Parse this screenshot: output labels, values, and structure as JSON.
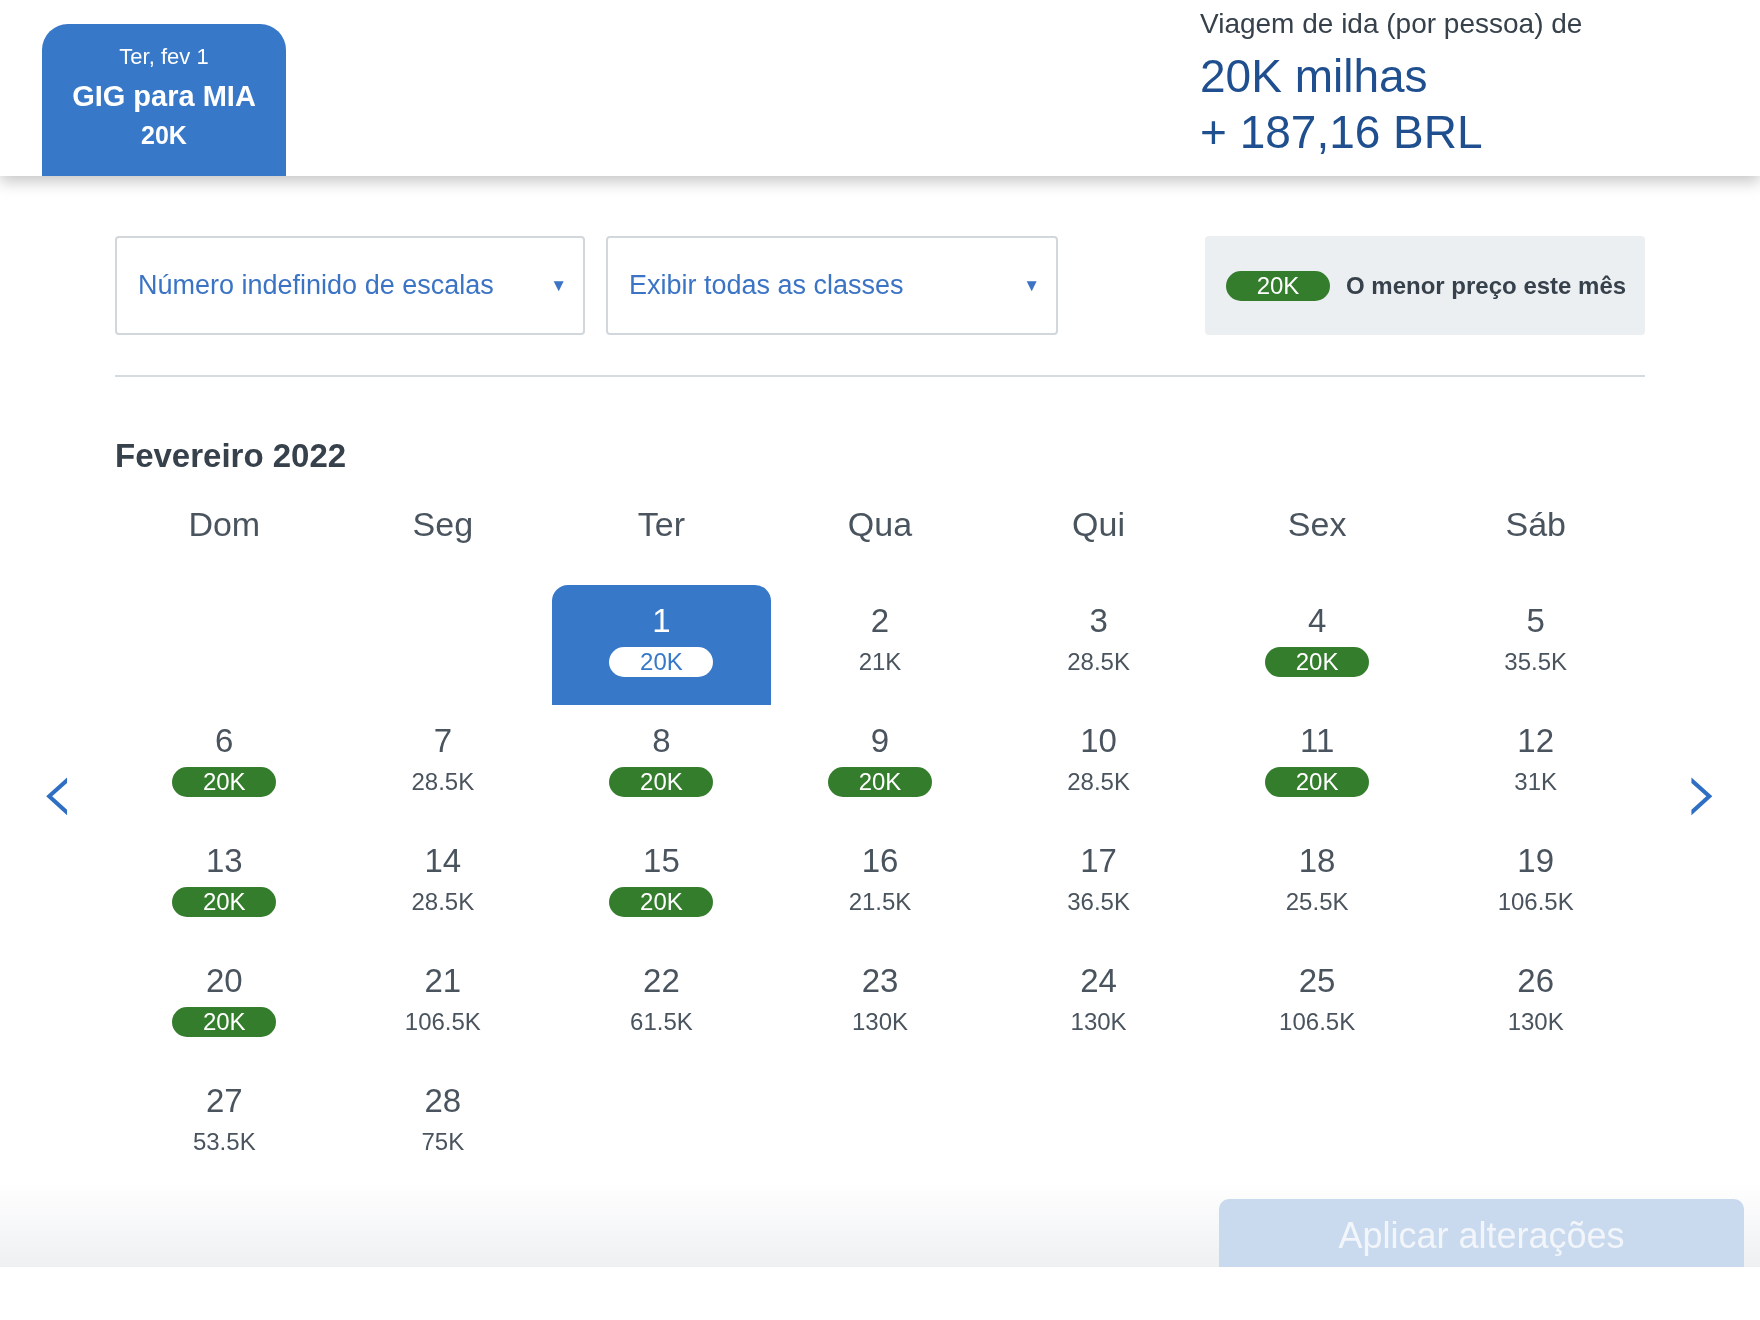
{
  "flight_tab": {
    "date": "Ter, fev 1",
    "route": "GIG para MIA",
    "price": "20K",
    "selected": true
  },
  "fare_summary": {
    "label": "Viagem de ida (por pessoa) de",
    "miles": "20K milhas",
    "cash": "+ 187,16 BRL"
  },
  "filters": [
    {
      "value": "Número indefinido de escalas",
      "arrow": "▼"
    },
    {
      "value": "Exibir todas as classes",
      "arrow": "▼"
    }
  ],
  "legend": {
    "badge": "20K",
    "text": "O menor preço este mês"
  },
  "calendar": {
    "month": "Fevereiro 2022",
    "prev": "‹",
    "next": "›",
    "weekdays": [
      "Dom",
      "Seg",
      "Ter",
      "Qua",
      "Qui",
      "Sex",
      "Sáb"
    ],
    "weeks": [
      {
        "cells": [
          {
            "kind": "blank"
          },
          {
            "kind": "blank"
          },
          {
            "kind": "day",
            "day": "1",
            "price": "20K",
            "lowest": true,
            "selected": true
          },
          {
            "kind": "day",
            "day": "2",
            "price": "21K",
            "lowest": false,
            "selected": false
          },
          {
            "kind": "day",
            "day": "3",
            "price": "28.5K",
            "lowest": false,
            "selected": false
          },
          {
            "kind": "day",
            "day": "4",
            "price": "20K",
            "lowest": true,
            "selected": false
          },
          {
            "kind": "day",
            "day": "5",
            "price": "35.5K",
            "lowest": false,
            "selected": false
          }
        ]
      },
      {
        "cells": [
          {
            "kind": "day",
            "day": "6",
            "price": "20K",
            "lowest": true,
            "selected": false
          },
          {
            "kind": "day",
            "day": "7",
            "price": "28.5K",
            "lowest": false,
            "selected": false
          },
          {
            "kind": "day",
            "day": "8",
            "price": "20K",
            "lowest": true,
            "selected": false
          },
          {
            "kind": "day",
            "day": "9",
            "price": "20K",
            "lowest": true,
            "selected": false
          },
          {
            "kind": "day",
            "day": "10",
            "price": "28.5K",
            "lowest": false,
            "selected": false
          },
          {
            "kind": "day",
            "day": "11",
            "price": "20K",
            "lowest": true,
            "selected": false
          },
          {
            "kind": "day",
            "day": "12",
            "price": "31K",
            "lowest": false,
            "selected": false
          }
        ]
      },
      {
        "cells": [
          {
            "kind": "day",
            "day": "13",
            "price": "20K",
            "lowest": true,
            "selected": false
          },
          {
            "kind": "day",
            "day": "14",
            "price": "28.5K",
            "lowest": false,
            "selected": false
          },
          {
            "kind": "day",
            "day": "15",
            "price": "20K",
            "lowest": true,
            "selected": false
          },
          {
            "kind": "day",
            "day": "16",
            "price": "21.5K",
            "lowest": false,
            "selected": false
          },
          {
            "kind": "day",
            "day": "17",
            "price": "36.5K",
            "lowest": false,
            "selected": false
          },
          {
            "kind": "day",
            "day": "18",
            "price": "25.5K",
            "lowest": false,
            "selected": false
          },
          {
            "kind": "day",
            "day": "19",
            "price": "106.5K",
            "lowest": false,
            "selected": false
          }
        ]
      },
      {
        "cells": [
          {
            "kind": "day",
            "day": "20",
            "price": "20K",
            "lowest": true,
            "selected": false
          },
          {
            "kind": "day",
            "day": "21",
            "price": "106.5K",
            "lowest": false,
            "selected": false
          },
          {
            "kind": "day",
            "day": "22",
            "price": "61.5K",
            "lowest": false,
            "selected": false
          },
          {
            "kind": "day",
            "day": "23",
            "price": "130K",
            "lowest": false,
            "selected": false
          },
          {
            "kind": "day",
            "day": "24",
            "price": "130K",
            "lowest": false,
            "selected": false
          },
          {
            "kind": "day",
            "day": "25",
            "price": "106.5K",
            "lowest": false,
            "selected": false
          },
          {
            "kind": "day",
            "day": "26",
            "price": "130K",
            "lowest": false,
            "selected": false
          }
        ]
      },
      {
        "cells": [
          {
            "kind": "day",
            "day": "27",
            "price": "53.5K",
            "lowest": false,
            "selected": false
          },
          {
            "kind": "day",
            "day": "28",
            "price": "75K",
            "lowest": false,
            "selected": false
          }
        ]
      }
    ]
  },
  "apply_button": {
    "label": "Aplicar alterações",
    "disabled": true
  }
}
